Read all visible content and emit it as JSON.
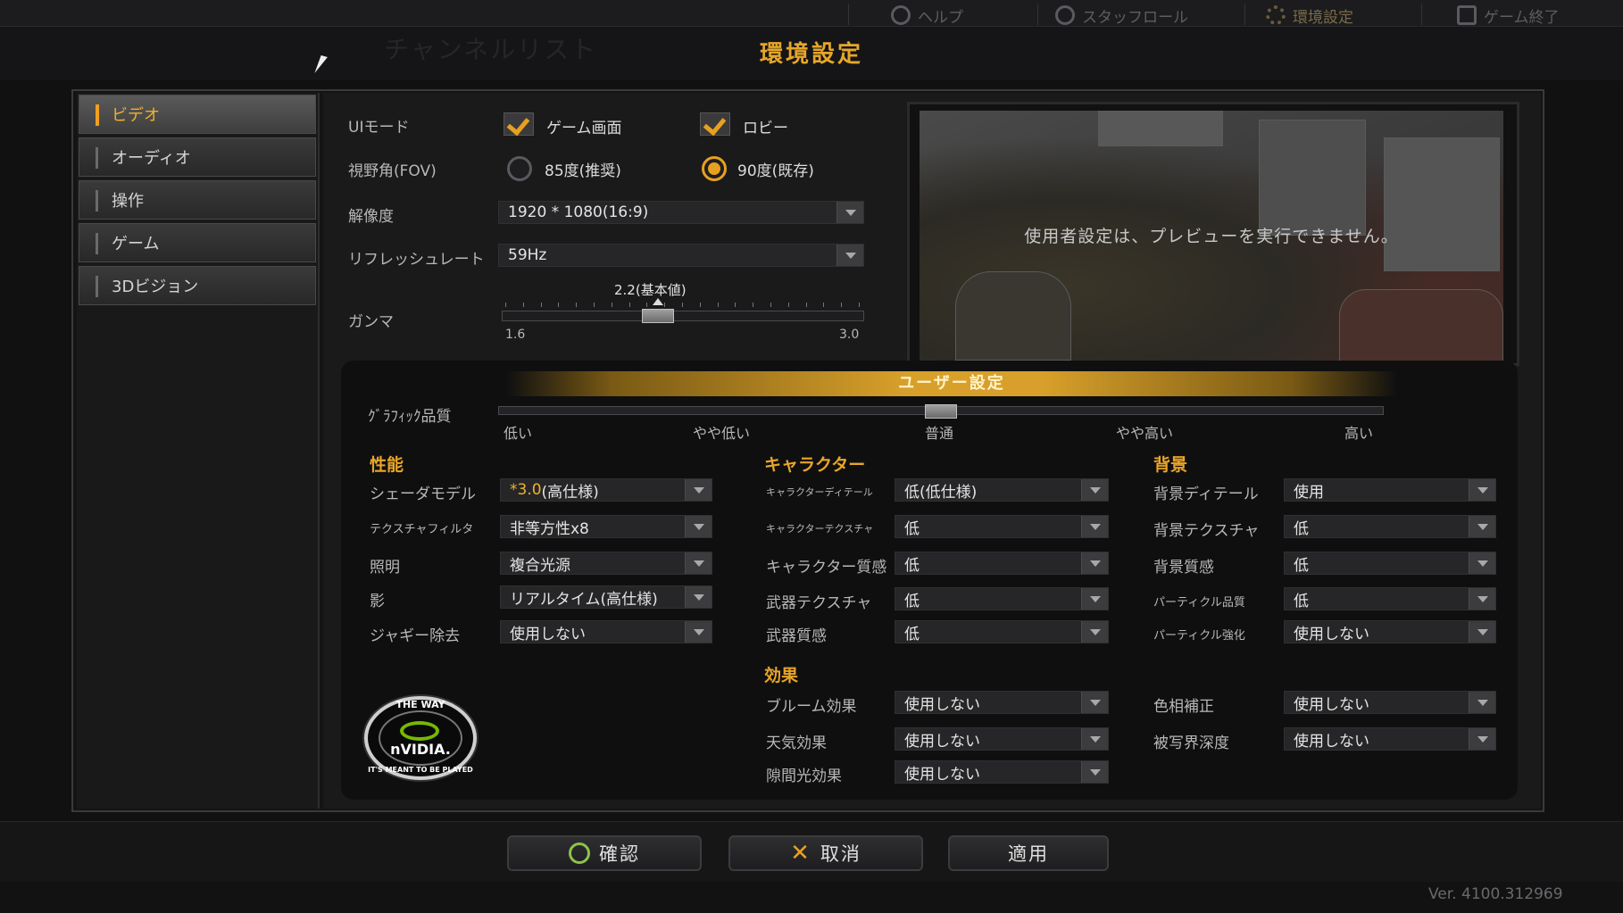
{
  "top_menu": {
    "help": "ヘルプ",
    "staff_roll": "スタッフロール",
    "settings": "環境設定",
    "quit": "ゲーム終了"
  },
  "background_ghost_text": "チャンネルリスト",
  "dialog_title": "環境設定",
  "sidebar": {
    "items": [
      {
        "label": "ビデオ",
        "active": true
      },
      {
        "label": "オーディオ",
        "active": false
      },
      {
        "label": "操作",
        "active": false
      },
      {
        "label": "ゲーム",
        "active": false
      },
      {
        "label": "3Dビジョン",
        "active": false
      }
    ]
  },
  "video": {
    "ui_mode_label": "UIモード",
    "ui_mode_game": "ゲーム画面",
    "ui_mode_lobby": "ロビー",
    "fov_label": "視野角(FOV)",
    "fov_85": "85度(推奨)",
    "fov_90": "90度(既存)",
    "resolution_label": "解像度",
    "resolution_value": "1920 * 1080(16:9)",
    "refresh_label": "リフレッシュレート",
    "refresh_value": "59Hz",
    "gamma_label": "ガンマ",
    "gamma_value": "2.2(基本値)",
    "gamma_level": 0.43,
    "gamma_min": "1.6",
    "gamma_max": "3.0"
  },
  "preview": {
    "message": "使用者設定は、プレビューを実行できません。"
  },
  "user_settings": {
    "banner": "ユーザー設定",
    "quality_label": "ｸﾞﾗﾌｨｯｸ品質",
    "quality_level": 0.5,
    "quality_ticks": [
      "低い",
      "やや低い",
      "普通",
      "やや高い",
      "高い"
    ]
  },
  "performance": {
    "title": "性能",
    "shader_label": "シェーダモデル",
    "shader_prefix": "*3.0",
    "shader_suffix": "(高仕様)",
    "texture_filter_label": "テクスチャフィルタ",
    "texture_filter_value": "非等方性x8",
    "lighting_label": "照明",
    "lighting_value": "複合光源",
    "shadow_label": "影",
    "shadow_value": "リアルタイム(高仕様)",
    "aa_label": "ジャギー除去",
    "aa_value": "使用しない"
  },
  "character": {
    "title": "キャラクター",
    "detail_label": "キャラクターディテール",
    "detail_value": "低(低仕様)",
    "texture_label": "キャラクターテクスチャ",
    "texture_value": "低",
    "material_label": "キャラクター質感",
    "material_value": "低",
    "weapon_texture_label": "武器テクスチャ",
    "weapon_texture_value": "低",
    "weapon_material_label": "武器質感",
    "weapon_material_value": "低"
  },
  "background": {
    "title": "背景",
    "detail_label": "背景ディテール",
    "detail_value": "使用",
    "texture_label": "背景テクスチャ",
    "texture_value": "低",
    "material_label": "背景質感",
    "material_value": "低",
    "particle_quality_label": "パーティクル品質",
    "particle_quality_value": "低",
    "particle_boost_label": "パーティクル強化",
    "particle_boost_value": "使用しない"
  },
  "effects": {
    "title": "効果",
    "bloom_label": "ブルーム効果",
    "bloom_value": "使用しない",
    "weather_label": "天気効果",
    "weather_value": "使用しない",
    "godray_label": "隙間光効果",
    "godray_value": "使用しない",
    "color_label": "色相補正",
    "color_value": "使用しない",
    "dof_label": "被写界深度",
    "dof_value": "使用しない"
  },
  "nvidia": {
    "top": "THE WAY",
    "word": "nVIDIA.",
    "bottom": "IT'S MEANT TO BE PLAYED"
  },
  "buttons": {
    "confirm": "確認",
    "cancel": "取消",
    "apply": "適用"
  },
  "version": "Ver. 4100.312969",
  "colors": {
    "accent": "#e8a020",
    "title": "#e6a62a",
    "nvidia_green": "#76b900"
  }
}
